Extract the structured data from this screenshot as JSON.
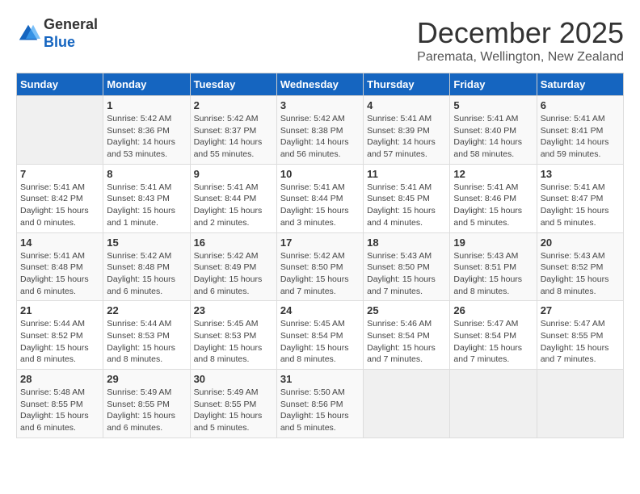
{
  "logo": {
    "general": "General",
    "blue": "Blue"
  },
  "header": {
    "month_title": "December 2025",
    "location": "Paremata, Wellington, New Zealand"
  },
  "weekdays": [
    "Sunday",
    "Monday",
    "Tuesday",
    "Wednesday",
    "Thursday",
    "Friday",
    "Saturday"
  ],
  "weeks": [
    [
      {
        "day": "",
        "info": ""
      },
      {
        "day": "1",
        "info": "Sunrise: 5:42 AM\nSunset: 8:36 PM\nDaylight: 14 hours\nand 53 minutes."
      },
      {
        "day": "2",
        "info": "Sunrise: 5:42 AM\nSunset: 8:37 PM\nDaylight: 14 hours\nand 55 minutes."
      },
      {
        "day": "3",
        "info": "Sunrise: 5:42 AM\nSunset: 8:38 PM\nDaylight: 14 hours\nand 56 minutes."
      },
      {
        "day": "4",
        "info": "Sunrise: 5:41 AM\nSunset: 8:39 PM\nDaylight: 14 hours\nand 57 minutes."
      },
      {
        "day": "5",
        "info": "Sunrise: 5:41 AM\nSunset: 8:40 PM\nDaylight: 14 hours\nand 58 minutes."
      },
      {
        "day": "6",
        "info": "Sunrise: 5:41 AM\nSunset: 8:41 PM\nDaylight: 14 hours\nand 59 minutes."
      }
    ],
    [
      {
        "day": "7",
        "info": "Sunrise: 5:41 AM\nSunset: 8:42 PM\nDaylight: 15 hours\nand 0 minutes."
      },
      {
        "day": "8",
        "info": "Sunrise: 5:41 AM\nSunset: 8:43 PM\nDaylight: 15 hours\nand 1 minute."
      },
      {
        "day": "9",
        "info": "Sunrise: 5:41 AM\nSunset: 8:44 PM\nDaylight: 15 hours\nand 2 minutes."
      },
      {
        "day": "10",
        "info": "Sunrise: 5:41 AM\nSunset: 8:44 PM\nDaylight: 15 hours\nand 3 minutes."
      },
      {
        "day": "11",
        "info": "Sunrise: 5:41 AM\nSunset: 8:45 PM\nDaylight: 15 hours\nand 4 minutes."
      },
      {
        "day": "12",
        "info": "Sunrise: 5:41 AM\nSunset: 8:46 PM\nDaylight: 15 hours\nand 5 minutes."
      },
      {
        "day": "13",
        "info": "Sunrise: 5:41 AM\nSunset: 8:47 PM\nDaylight: 15 hours\nand 5 minutes."
      }
    ],
    [
      {
        "day": "14",
        "info": "Sunrise: 5:41 AM\nSunset: 8:48 PM\nDaylight: 15 hours\nand 6 minutes."
      },
      {
        "day": "15",
        "info": "Sunrise: 5:42 AM\nSunset: 8:48 PM\nDaylight: 15 hours\nand 6 minutes."
      },
      {
        "day": "16",
        "info": "Sunrise: 5:42 AM\nSunset: 8:49 PM\nDaylight: 15 hours\nand 6 minutes."
      },
      {
        "day": "17",
        "info": "Sunrise: 5:42 AM\nSunset: 8:50 PM\nDaylight: 15 hours\nand 7 minutes."
      },
      {
        "day": "18",
        "info": "Sunrise: 5:43 AM\nSunset: 8:50 PM\nDaylight: 15 hours\nand 7 minutes."
      },
      {
        "day": "19",
        "info": "Sunrise: 5:43 AM\nSunset: 8:51 PM\nDaylight: 15 hours\nand 8 minutes."
      },
      {
        "day": "20",
        "info": "Sunrise: 5:43 AM\nSunset: 8:52 PM\nDaylight: 15 hours\nand 8 minutes."
      }
    ],
    [
      {
        "day": "21",
        "info": "Sunrise: 5:44 AM\nSunset: 8:52 PM\nDaylight: 15 hours\nand 8 minutes."
      },
      {
        "day": "22",
        "info": "Sunrise: 5:44 AM\nSunset: 8:53 PM\nDaylight: 15 hours\nand 8 minutes."
      },
      {
        "day": "23",
        "info": "Sunrise: 5:45 AM\nSunset: 8:53 PM\nDaylight: 15 hours\nand 8 minutes."
      },
      {
        "day": "24",
        "info": "Sunrise: 5:45 AM\nSunset: 8:54 PM\nDaylight: 15 hours\nand 8 minutes."
      },
      {
        "day": "25",
        "info": "Sunrise: 5:46 AM\nSunset: 8:54 PM\nDaylight: 15 hours\nand 7 minutes."
      },
      {
        "day": "26",
        "info": "Sunrise: 5:47 AM\nSunset: 8:54 PM\nDaylight: 15 hours\nand 7 minutes."
      },
      {
        "day": "27",
        "info": "Sunrise: 5:47 AM\nSunset: 8:55 PM\nDaylight: 15 hours\nand 7 minutes."
      }
    ],
    [
      {
        "day": "28",
        "info": "Sunrise: 5:48 AM\nSunset: 8:55 PM\nDaylight: 15 hours\nand 6 minutes."
      },
      {
        "day": "29",
        "info": "Sunrise: 5:49 AM\nSunset: 8:55 PM\nDaylight: 15 hours\nand 6 minutes."
      },
      {
        "day": "30",
        "info": "Sunrise: 5:49 AM\nSunset: 8:55 PM\nDaylight: 15 hours\nand 5 minutes."
      },
      {
        "day": "31",
        "info": "Sunrise: 5:50 AM\nSunset: 8:56 PM\nDaylight: 15 hours\nand 5 minutes."
      },
      {
        "day": "",
        "info": ""
      },
      {
        "day": "",
        "info": ""
      },
      {
        "day": "",
        "info": ""
      }
    ]
  ]
}
